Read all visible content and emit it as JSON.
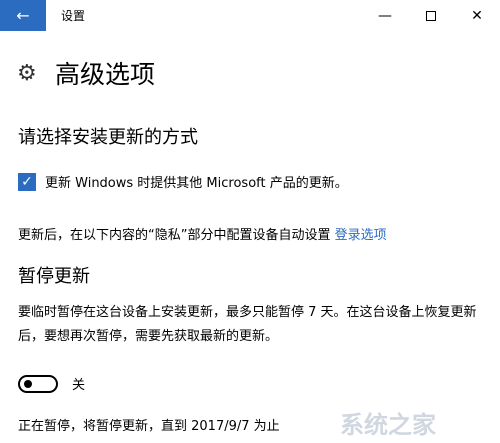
{
  "titlebar": {
    "title": "设置",
    "back_glyph": "←",
    "min_glyph": "—",
    "close_glyph": "✕"
  },
  "page": {
    "title": "高级选项"
  },
  "update_method": {
    "heading": "请选择安装更新的方式",
    "checkbox_label": "更新 Windows 时提供其他 Microsoft 产品的更新。",
    "checked": true
  },
  "signin": {
    "text": "更新后，在以下内容的“隐私”部分中配置设备自动设置",
    "link": "登录选项"
  },
  "pause": {
    "heading": "暂停更新",
    "description": "要临时暂停在这台设备上安装更新，最多只能暂停 7 天。在这台设备上恢复更新后，要想再次暂停，需要先获取最新的更新。",
    "toggle_label": "关",
    "toggle_on": false,
    "status": "正在暂停，将暂停更新，直到 2017/9/7 为止"
  },
  "watermark": {
    "text": "系统之家"
  },
  "colors": {
    "accent": "#2b6cc0"
  }
}
